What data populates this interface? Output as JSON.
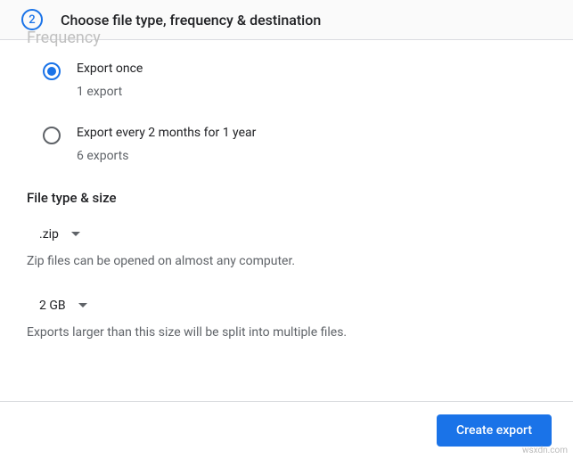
{
  "step": {
    "number": "2",
    "title": "Choose file type, frequency & destination"
  },
  "ghost_heading": "Frequency",
  "frequency": {
    "options": [
      {
        "title": "Export once",
        "sub": "1 export",
        "selected": true
      },
      {
        "title": "Export every 2 months for 1 year",
        "sub": "6 exports",
        "selected": false
      }
    ]
  },
  "filetype_section": {
    "heading": "File type & size",
    "filetype": {
      "value": ".zip",
      "help": "Zip files can be opened on almost any computer."
    },
    "size": {
      "value": "2 GB",
      "help": "Exports larger than this size will be split into multiple files."
    }
  },
  "actions": {
    "create_export": "Create export"
  },
  "watermark": "wsxdn.com"
}
